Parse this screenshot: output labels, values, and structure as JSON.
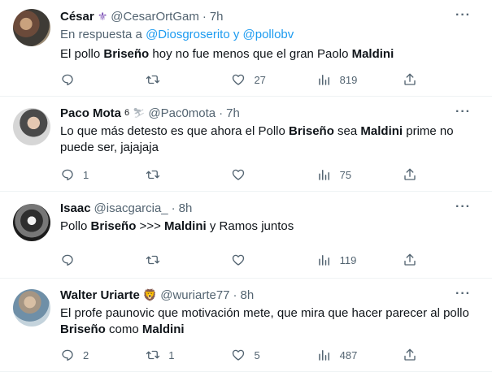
{
  "tweets": [
    {
      "name": "César",
      "badge": "⚜",
      "handle": "@CesarOrtGam",
      "dot": "·",
      "time": "7h",
      "reply_prefix": "En respuesta a",
      "reply_to": "@Diosgroserito y @pollobv",
      "text_parts": [
        "El pollo ",
        "Briseño",
        " hoy no fue menos que el gran Paolo ",
        "Maldini",
        ""
      ],
      "replies": "",
      "retweets": "",
      "likes": "27",
      "views": "819"
    },
    {
      "name": "Paco Mota",
      "badge_sup": "6",
      "badge": "⛷",
      "handle": "@Pac0mota",
      "dot": "·",
      "time": "7h",
      "text_parts": [
        "Lo que más detesto es que ahora el Pollo ",
        "Briseño",
        " sea ",
        "Maldini",
        " prime no puede ser, jajajaja"
      ],
      "replies": "1",
      "retweets": "",
      "likes": "",
      "views": "75"
    },
    {
      "name": "Isaac",
      "handle": "@isacgarcia_",
      "dot": "·",
      "time": "8h",
      "text_parts": [
        "Pollo ",
        "Briseño",
        " >>> ",
        "Maldini",
        " y Ramos juntos"
      ],
      "replies": "",
      "retweets": "",
      "likes": "",
      "views": "119"
    },
    {
      "name": "Walter Uriarte",
      "badge": "🦁",
      "handle": "@wuriarte77",
      "dot": "·",
      "time": "8h",
      "text_parts": [
        "El profe paunovic que motivación mete, que mira que hacer parecer al pollo ",
        "Briseño",
        " como ",
        "Maldini",
        ""
      ],
      "replies": "2",
      "retweets": "1",
      "likes": "5",
      "views": "487"
    }
  ],
  "more_label": "···"
}
